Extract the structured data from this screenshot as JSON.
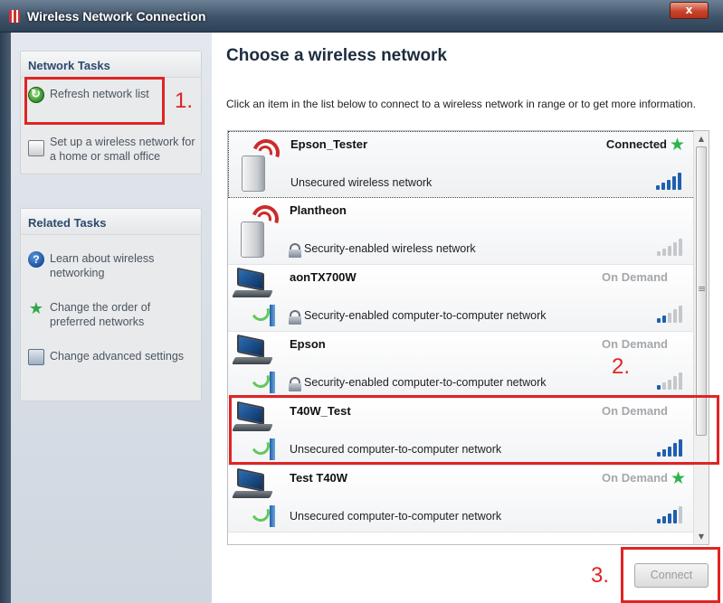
{
  "window": {
    "title": "Wireless Network Connection",
    "close_label": "x"
  },
  "sidebar": {
    "network_tasks": {
      "header": "Network Tasks",
      "items": [
        {
          "label": "Refresh network list",
          "icon": "refresh-icon"
        },
        {
          "label": "Set up a wireless network for a home or small office",
          "icon": "network-setup-icon"
        }
      ]
    },
    "related_tasks": {
      "header": "Related Tasks",
      "items": [
        {
          "label": "Learn about wireless networking",
          "icon": "help-icon"
        },
        {
          "label": "Change the order of preferred networks",
          "icon": "star-icon"
        },
        {
          "label": "Change advanced settings",
          "icon": "settings-icon"
        }
      ]
    }
  },
  "main": {
    "title": "Choose a wireless network",
    "description": "Click an item in the list below to connect to a wireless network in range or to get more information.",
    "networks": [
      {
        "name": "Epson_Tester",
        "description": "Unsecured wireless network",
        "status": "Connected",
        "starred": true,
        "secured": false,
        "type": "access-point",
        "signal_bars": 5
      },
      {
        "name": "Plantheon",
        "description": "Security-enabled wireless network",
        "status": "",
        "starred": false,
        "secured": true,
        "type": "access-point",
        "signal_bars": 0
      },
      {
        "name": "aonTX700W",
        "description": "Security-enabled computer-to-computer network",
        "status": "On Demand",
        "starred": false,
        "secured": true,
        "type": "ad-hoc",
        "signal_bars": 2
      },
      {
        "name": "Epson",
        "description": "Security-enabled computer-to-computer network",
        "status": "On Demand",
        "starred": false,
        "secured": true,
        "type": "ad-hoc",
        "signal_bars": 1
      },
      {
        "name": "T40W_Test",
        "description": "Unsecured computer-to-computer network",
        "status": "On Demand",
        "starred": false,
        "secured": false,
        "type": "ad-hoc",
        "signal_bars": 5
      },
      {
        "name": "Test T40W",
        "description": "Unsecured computer-to-computer network",
        "status": "On Demand",
        "starred": true,
        "secured": false,
        "type": "ad-hoc",
        "signal_bars": 4
      }
    ],
    "connect_label": "Connect"
  },
  "annotations": [
    "1.",
    "2.",
    "3."
  ],
  "colors": {
    "annotation": "#e02424",
    "signal_active": "#1e5fb0",
    "signal_inactive": "#c4c8cc",
    "star": "#30b24e"
  }
}
